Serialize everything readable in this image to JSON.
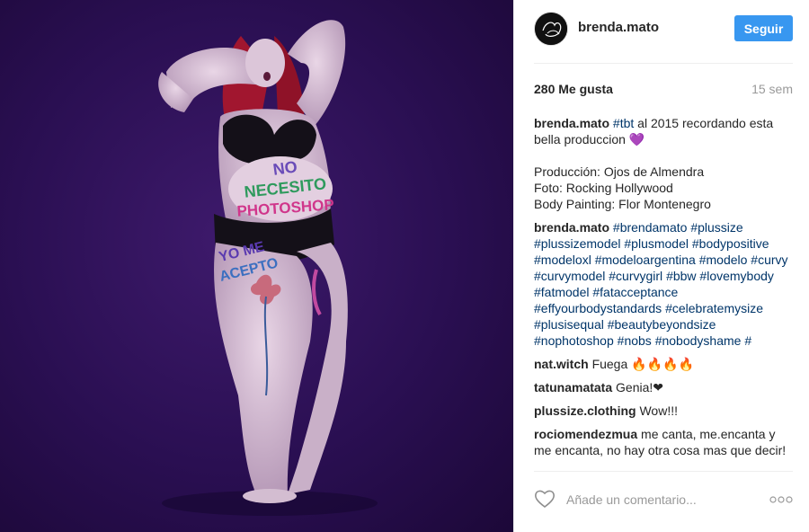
{
  "post": {
    "image_alt": "",
    "body_text": {
      "line1": "NO",
      "line2": "NECESITO",
      "line3": "PHOTOSHOP",
      "leg1": "YO ME",
      "leg2": "ACEPTO"
    }
  },
  "header": {
    "avatar_text": "Brenda Mato",
    "username": "brenda.mato",
    "follow_label": "Seguir"
  },
  "stats": {
    "likes": "280 Me gusta",
    "time": "15 sem"
  },
  "caption": {
    "user": "brenda.mato",
    "tag": "#tbt",
    "text": " al 2015 recordando esta bella produccion 💜",
    "credits": "Producción: Ojos de Almendra\nFoto: Rocking Hollywood\nBody Painting: Flor Montenegro"
  },
  "comments": [
    {
      "user": "brenda.mato",
      "tags": [
        "#brendamato",
        "#plussize",
        "#plussizemodel",
        "#plusmodel",
        "#bodypositive",
        "#modeloxl",
        "#modeloargentina",
        "#modelo",
        "#curvy",
        "#curvymodel",
        "#curvygirl",
        "#bbw",
        "#lovemybody",
        "#fatmodel",
        "#fatacceptance",
        "#effyourbodystandards",
        "#celebratemysize",
        "#plusisequal",
        "#beautybeyondsize",
        "#nophotoshop",
        "#nobs",
        "#nobodyshame",
        "#"
      ]
    },
    {
      "user": "nat.witch",
      "text": "Fuega 🔥🔥🔥🔥"
    },
    {
      "user": "tatunamatata",
      "text": "Genia!❤"
    },
    {
      "user": "plussize.clothing",
      "text": "Wow!!!"
    },
    {
      "user": "rociomendezmua",
      "text": "me canta, me.encanta y me encanta, no hay otra cosa mas que decir!"
    }
  ],
  "footer": {
    "comment_placeholder": "Añade un comentario...",
    "like_icon": "heart-outline-icon",
    "more_icon": "more-options-icon"
  }
}
